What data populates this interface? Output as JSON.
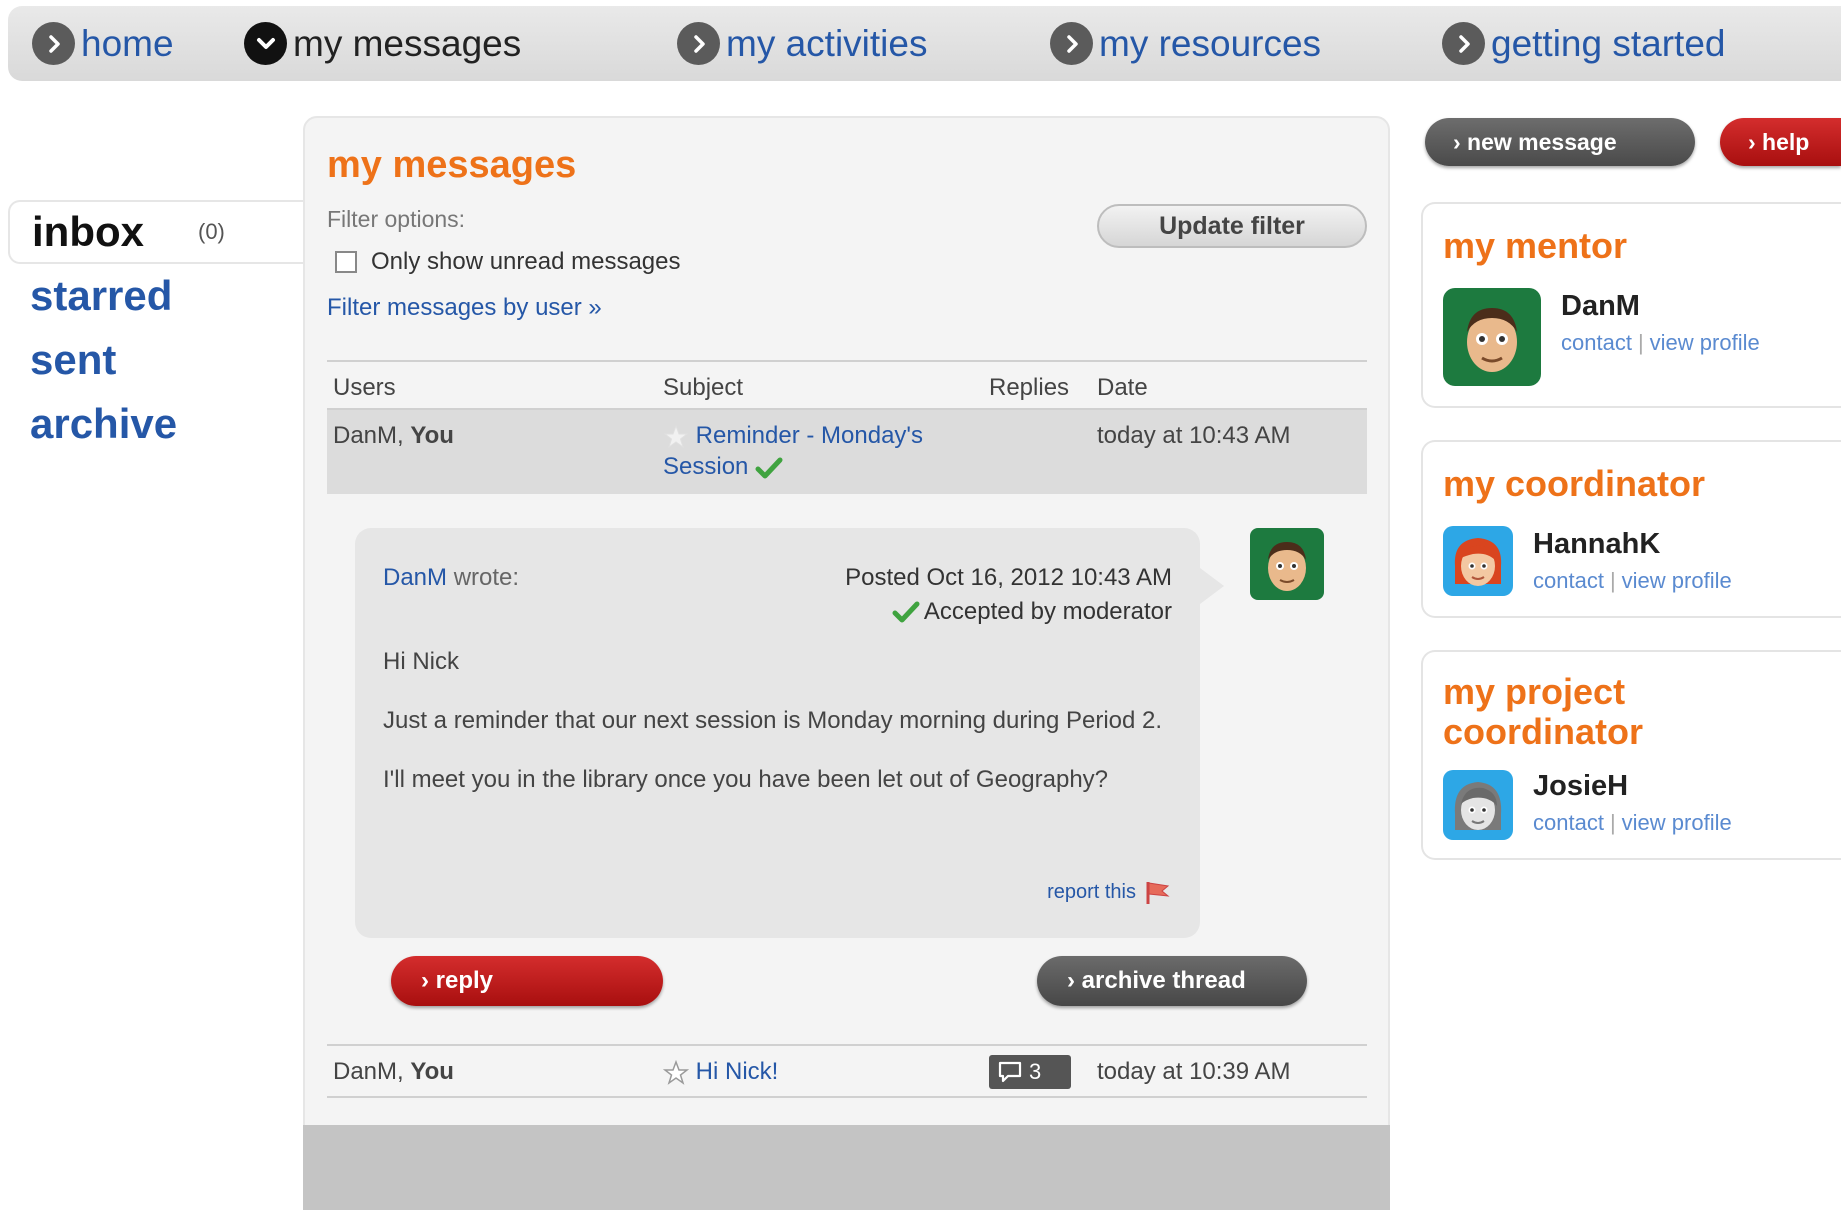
{
  "nav": {
    "items": [
      {
        "label": "home"
      },
      {
        "label": "my messages"
      },
      {
        "label": "my activities"
      },
      {
        "label": "my resources"
      },
      {
        "label": "getting started"
      }
    ]
  },
  "sidebar": {
    "inbox_label": "inbox",
    "inbox_count": "(0)",
    "items": [
      {
        "label": "starred"
      },
      {
        "label": "sent"
      },
      {
        "label": "archive"
      }
    ]
  },
  "main": {
    "title": "my messages",
    "filter_options_label": "Filter options:",
    "update_filter_label": "Update filter",
    "unread_label": "Only show unread messages",
    "filter_by_user_label": "Filter messages by user »",
    "columns": {
      "users": "Users",
      "subject": "Subject",
      "replies": "Replies",
      "date": "Date"
    },
    "rows": [
      {
        "users_name": "DanM",
        "users_sep": ", ",
        "users_you": "You",
        "subject": "Reminder - Monday's Session",
        "replies": "",
        "date": "today at 10:43 AM"
      },
      {
        "users_name": "DanM",
        "users_sep": ", ",
        "users_you": "You",
        "subject": "Hi Nick!",
        "replies": "3",
        "date": "today at 10:39 AM"
      }
    ],
    "message": {
      "author": "DanM",
      "wrote": " wrote:",
      "posted": "Posted Oct 16, 2012 10:43 AM",
      "accepted": "Accepted by moderator",
      "paragraphs": [
        "Hi Nick",
        "Just a reminder that our next session is Monday morning during Period 2.",
        "I'll meet you in the library once you have been let out of Geography?"
      ],
      "report_label": "report this"
    },
    "reply_label": "› reply",
    "archive_label": "› archive thread"
  },
  "right": {
    "new_message_label": "› new message",
    "help_label": "› help",
    "cards": [
      {
        "title": "my mentor",
        "name": "DanM",
        "contact": "contact",
        "view": "view profile"
      },
      {
        "title": "my coordinator",
        "name": "HannahK",
        "contact": "contact",
        "view": "view profile"
      },
      {
        "title": "my project coordinator",
        "name": "JosieH",
        "contact": "contact",
        "view": "view profile"
      }
    ]
  },
  "colors": {
    "accent_orange": "#ee7219",
    "link_blue": "#2557a7",
    "button_red": "#c0181b",
    "button_gray": "#575757"
  }
}
